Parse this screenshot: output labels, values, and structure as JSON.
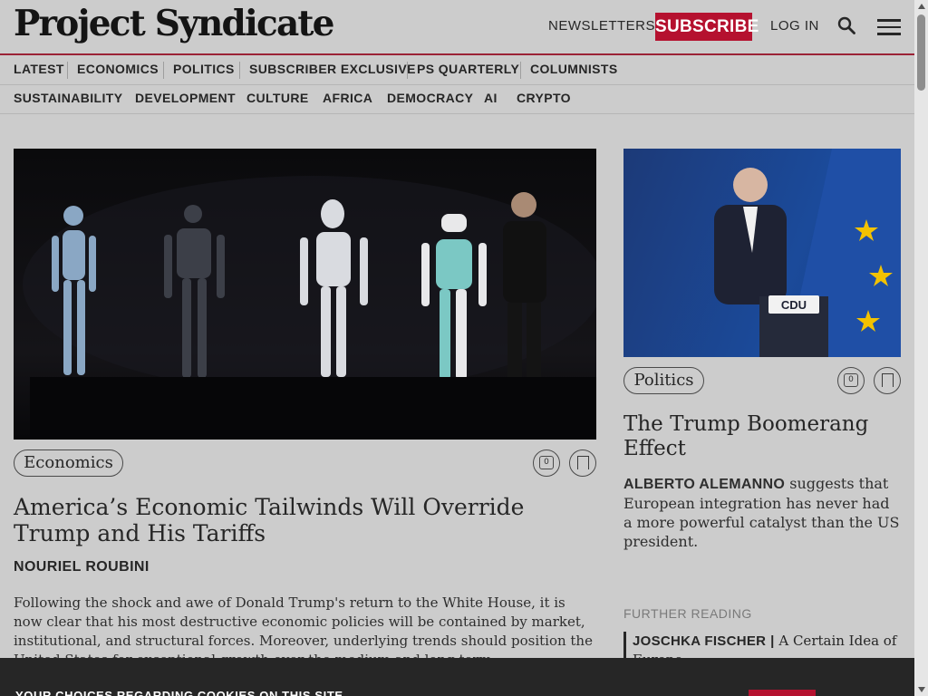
{
  "site": {
    "logo_text": "Project Syndicate",
    "brand_color": "#b5112f"
  },
  "header": {
    "newsletters": "NEWSLETTERS",
    "subscribe": "SUBSCRIBE",
    "login": "LOG IN",
    "search_icon": "search-icon",
    "menu_icon": "hamburger-menu-icon"
  },
  "nav": {
    "row1": [
      "LATEST",
      "ECONOMICS",
      "POLITICS",
      "SUBSCRIBER EXCLUSIVE",
      "PS QUARTERLY",
      "COLUMNISTS"
    ],
    "row2": [
      "SUSTAINABILITY",
      "DEVELOPMENT",
      "CULTURE",
      "AFRICA",
      "DEMOCRACY",
      "AI",
      "CRYPTO"
    ]
  },
  "main_article": {
    "category": "Economics",
    "comment_count": "0",
    "title": "America’s Economic Tailwinds Will Override Trump and His Tariffs",
    "author": "NOURIEL ROUBINI",
    "excerpt": "Following the shock and awe of Donald Trump's return to the White House, it is now clear that his most destructive economic policies will be contained by market, institutional, and structural forces. Moreover, underlying trends should position the United States for exceptional growth over the medium and long term."
  },
  "side_article": {
    "category": "Politics",
    "comment_count": "0",
    "title": "The Trump Boomerang Effect",
    "author": "ALBERTO ALEMANNO",
    "summary": "suggests that European integration has never had a more powerful catalyst than the US president."
  },
  "further_reading": {
    "label": "FURTHER READING",
    "items": [
      {
        "author": "JOSCHKA FISCHER",
        "separator": "|",
        "title": "A Certain Idea of Europe"
      }
    ]
  },
  "cookie_banner": {
    "title": "YOUR CHOICES REGARDING COOKIES ON THIS SITE"
  }
}
